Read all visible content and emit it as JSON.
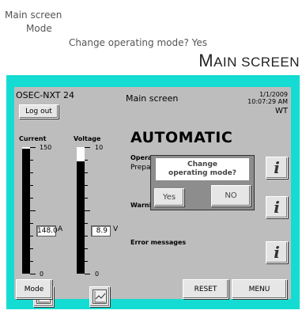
{
  "breadcrumb": [
    "Main screen",
    "Mode",
    "Change operating mode? Yes"
  ],
  "heading": {
    "first": "M",
    "rest": "AIN SCREEN"
  },
  "hmi": {
    "device": "OSEC-NXT 24",
    "logout": "Log out",
    "title": "Main screen",
    "date": "1/1/2009",
    "time": "10:07:29 AM",
    "code": "WT",
    "mode": "AUTOMATIC",
    "current": {
      "label": "Current",
      "max": "150",
      "min": "0",
      "value": "148.0",
      "unit": "A",
      "level": 0.987
    },
    "voltage": {
      "label": "Voltage",
      "max": "10",
      "min": "0",
      "value": "8.9",
      "unit": "V",
      "level": 0.89
    },
    "operating_label": "Operati",
    "operating_value": "Prepara",
    "warnings_label": "Warnin",
    "error_label": "Error messages",
    "info_glyph": "i",
    "dialog": {
      "line1": "Change",
      "line2": "operating mode?",
      "yes": "Yes",
      "no": "NO"
    },
    "bottom": {
      "mode": "Mode",
      "reset": "RESET",
      "menu": "MENU"
    }
  },
  "colors": {
    "frame": "#15dcd2",
    "screen": "#bdbdbd"
  }
}
